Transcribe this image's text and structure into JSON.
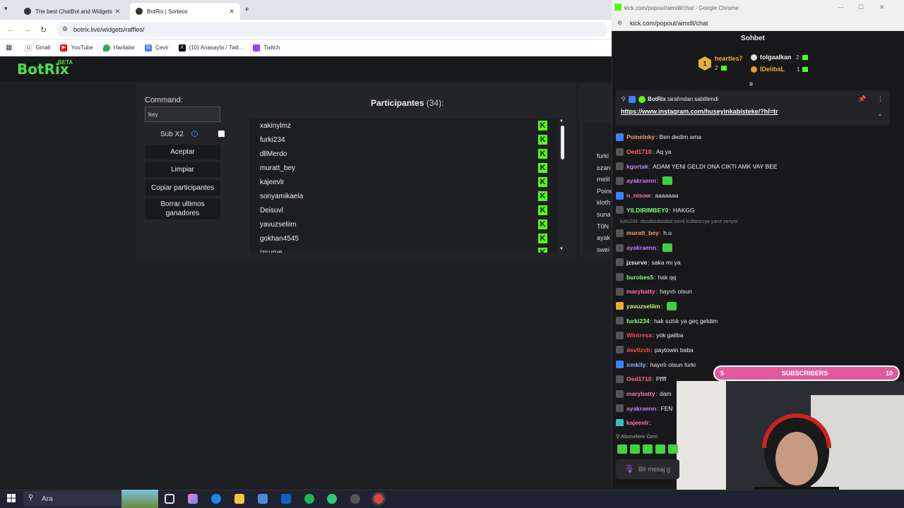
{
  "browser": {
    "tabs": [
      {
        "title": "The best ChatBot and Widgets",
        "active": false
      },
      {
        "title": "BotRix | Sorteos",
        "active": true
      }
    ],
    "url": "botrix.live/widgets/raffles/",
    "bookmarks": [
      "Gmail",
      "YouTube",
      "Haritalar",
      "Çevir",
      "(10) Anasayfa / Twit...",
      "Twitch"
    ]
  },
  "botrix": {
    "logo": "BotRix",
    "badge": "BETA",
    "command_label": "Command:",
    "command_value": "!key",
    "sub_label": "Sub X2",
    "sub_checked": false,
    "buttons": [
      "Aceptar",
      "Limpiar",
      "Copiar participantes",
      "Borrar ultimos ganadores"
    ],
    "participants_label": "Participantes",
    "participants_count": "(34):",
    "participants": [
      "xakinylmz",
      "furki234",
      "dllMerdo",
      "muratt_bey",
      "kajeevlr",
      "sonyamikaela",
      "Deisuvl",
      "yavuzseliim",
      "gokhan4545",
      "jzsurve"
    ],
    "right_names": [
      "furki",
      "ozan",
      "melil",
      "Poine",
      "kloth",
      "suna",
      "T0N",
      "ayak",
      "swei"
    ]
  },
  "popout": {
    "window_title": "kick.com/popout/aimdll/chat - Google Chrome",
    "url": "kick.com/popout/aimdll/chat",
    "header": "Sohbet",
    "top_gifters": [
      {
        "rank": "1",
        "name": "heartles7",
        "count": "2",
        "color": "#e6b12e"
      },
      {
        "rank": "",
        "name": "tolgaalkan",
        "count": "2",
        "color": "#eeeeee"
      },
      {
        "rank": "",
        "name": "IDelibaL",
        "count": "1",
        "color": "#e6b12e"
      }
    ],
    "pinned_by": "BotRix",
    "pinned_suffix": "tarafından sabitlendi",
    "pinned_link": "https://www.instagram.com/huseyinkabisteke/?hl=tr",
    "messages": [
      {
        "user": "Poinelnky",
        "text": "Ben dedim ama",
        "color": "#ff9e5e",
        "badge": "#3b82f6"
      },
      {
        "user": "Oed1710",
        "text": "Aq ya",
        "color": "#ff6b6b",
        "badge": "#555"
      },
      {
        "user": "kgortak",
        "text": "ADAM YENI GELDI ONA CIKTI AMK VAY BEE",
        "color": "#b98cff",
        "badge": "#555"
      },
      {
        "user": "ayakraenn",
        "text": "",
        "color": "#c77dff",
        "badge": "#555",
        "emote": true
      },
      {
        "user": "n_nisow",
        "text": "aaaaaaa",
        "color": "#ff77aa",
        "badge": "#3b82f6"
      },
      {
        "user": "YILDIRIMBEY0",
        "text": "HAKGG",
        "color": "#7cff7c",
        "badge": "#555"
      },
      {
        "reply": "furki234: dasdasdasdad isimli kullanıcıya yanıt veriyor"
      },
      {
        "user": "muratt_bey",
        "text": "h.o",
        "color": "#ff9e5e",
        "badge": "#555"
      },
      {
        "user": "ayakraenn",
        "text": "",
        "color": "#c77dff",
        "badge": "#555",
        "emote": true
      },
      {
        "user": "jzsurve",
        "text": "saka mı ya",
        "color": "#eeeeee",
        "badge": "#555"
      },
      {
        "user": "burobes5",
        "text": "hak qq",
        "color": "#7cff7c",
        "badge": "#555"
      },
      {
        "user": "marybatty",
        "text": "hayırlı olsun",
        "color": "#ff77aa",
        "badge": "#555"
      },
      {
        "user": "yavuzseliim",
        "text": "",
        "color": "#c6ff5e",
        "badge": "#e6b12e",
        "emote": true
      },
      {
        "user": "furki234",
        "text": "hak sızlık ya geç geldim",
        "color": "#7cff7c",
        "badge": "#555"
      },
      {
        "user": "Wintresa",
        "text": "yok galiba",
        "color": "#ff4d4d",
        "badge": "#555"
      },
      {
        "user": "dev0zvb",
        "text": "paytowin baba",
        "color": "#ff4d4d",
        "badge": "#555"
      },
      {
        "user": "irmklly",
        "text": "hayırlı olsun furki",
        "color": "#8ab4ff",
        "badge": "#3b82f6"
      },
      {
        "user": "Oed1710",
        "text": "Pffff",
        "color": "#ff6b6b",
        "badge": "#555"
      },
      {
        "user": "marybatty",
        "text": "dam",
        "color": "#ff77aa",
        "badge": "#555"
      },
      {
        "user": "ayakraenn",
        "text": "FEN",
        "color": "#c77dff",
        "badge": "#555"
      },
      {
        "user": "kajeevlr",
        "text": "",
        "color": "#ff77aa",
        "badge": "#30c0c0"
      }
    ],
    "subs_bar": {
      "left": "5",
      "label": "SUBSCRIBERS",
      "right": "10"
    },
    "subs_only": "Abonelere Özel",
    "input_placeholder": "Bir mesaj g"
  },
  "taskbar": {
    "search_placeholder": "Ara"
  }
}
